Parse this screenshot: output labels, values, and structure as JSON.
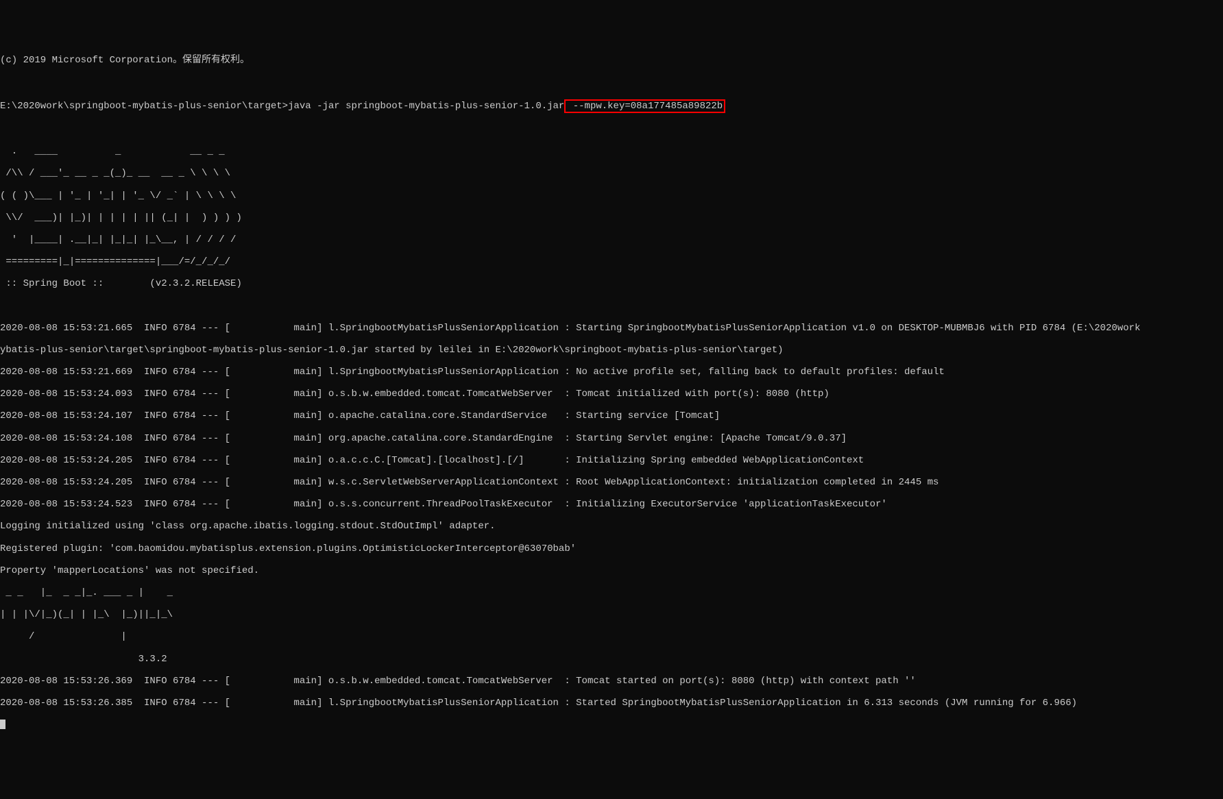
{
  "header": {
    "copyright": "(c) 2019 Microsoft Corporation。保留所有权利。",
    "prompt_prefix": "E:\\2020work\\springboot-mybatis-plus-senior\\target>java -jar springboot-mybatis-plus-senior-1.0.jar",
    "highlighted_arg": " --mpw.key=08a177485a89822b"
  },
  "banner": {
    "l1": "  .   ____          _            __ _ _",
    "l2": " /\\\\ / ___'_ __ _ _(_)_ __  __ _ \\ \\ \\ \\",
    "l3": "( ( )\\___ | '_ | '_| | '_ \\/ _` | \\ \\ \\ \\",
    "l4": " \\\\/  ___)| |_)| | | | | || (_| |  ) ) ) )",
    "l5": "  '  |____| .__|_| |_|_| |_\\__, | / / / /",
    "l6": " =========|_|==============|___/=/_/_/_/",
    "l7": " :: Spring Boot ::        (v2.3.2.RELEASE)"
  },
  "logs": {
    "l1": "2020-08-08 15:53:21.665  INFO 6784 --- [           main] l.SpringbootMybatisPlusSeniorApplication : Starting SpringbootMybatisPlusSeniorApplication v1.0 on DESKTOP-MUBMBJ6 with PID 6784 (E:\\2020work",
    "l2": "ybatis-plus-senior\\target\\springboot-mybatis-plus-senior-1.0.jar started by leilei in E:\\2020work\\springboot-mybatis-plus-senior\\target)",
    "l3": "2020-08-08 15:53:21.669  INFO 6784 --- [           main] l.SpringbootMybatisPlusSeniorApplication : No active profile set, falling back to default profiles: default",
    "l4": "2020-08-08 15:53:24.093  INFO 6784 --- [           main] o.s.b.w.embedded.tomcat.TomcatWebServer  : Tomcat initialized with port(s): 8080 (http)",
    "l5": "2020-08-08 15:53:24.107  INFO 6784 --- [           main] o.apache.catalina.core.StandardService   : Starting service [Tomcat]",
    "l6": "2020-08-08 15:53:24.108  INFO 6784 --- [           main] org.apache.catalina.core.StandardEngine  : Starting Servlet engine: [Apache Tomcat/9.0.37]",
    "l7": "2020-08-08 15:53:24.205  INFO 6784 --- [           main] o.a.c.c.C.[Tomcat].[localhost].[/]       : Initializing Spring embedded WebApplicationContext",
    "l8": "2020-08-08 15:53:24.205  INFO 6784 --- [           main] w.s.c.ServletWebServerApplicationContext : Root WebApplicationContext: initialization completed in 2445 ms",
    "l9": "2020-08-08 15:53:24.523  INFO 6784 --- [           main] o.s.s.concurrent.ThreadPoolTaskExecutor  : Initializing ExecutorService 'applicationTaskExecutor'",
    "l10": "Logging initialized using 'class org.apache.ibatis.logging.stdout.StdOutImpl' adapter.",
    "l11": "Registered plugin: 'com.baomidou.mybatisplus.extension.plugins.OptimisticLockerInterceptor@63070bab'",
    "l12": "Property 'mapperLocations' was not specified."
  },
  "mybatis_banner": {
    "l1": " _ _   |_  _ _|_. ___ _ |    _ ",
    "l2": "| | |\\/|_)(_| | |_\\  |_)||_|_\\ ",
    "l3": "     /               |         ",
    "l4": "                        3.3.2 "
  },
  "logs2": {
    "l1": "2020-08-08 15:53:26.369  INFO 6784 --- [           main] o.s.b.w.embedded.tomcat.TomcatWebServer  : Tomcat started on port(s): 8080 (http) with context path ''",
    "l2": "2020-08-08 15:53:26.385  INFO 6784 --- [           main] l.SpringbootMybatisPlusSeniorApplication : Started SpringbootMybatisPlusSeniorApplication in 6.313 seconds (JVM running for 6.966)"
  }
}
